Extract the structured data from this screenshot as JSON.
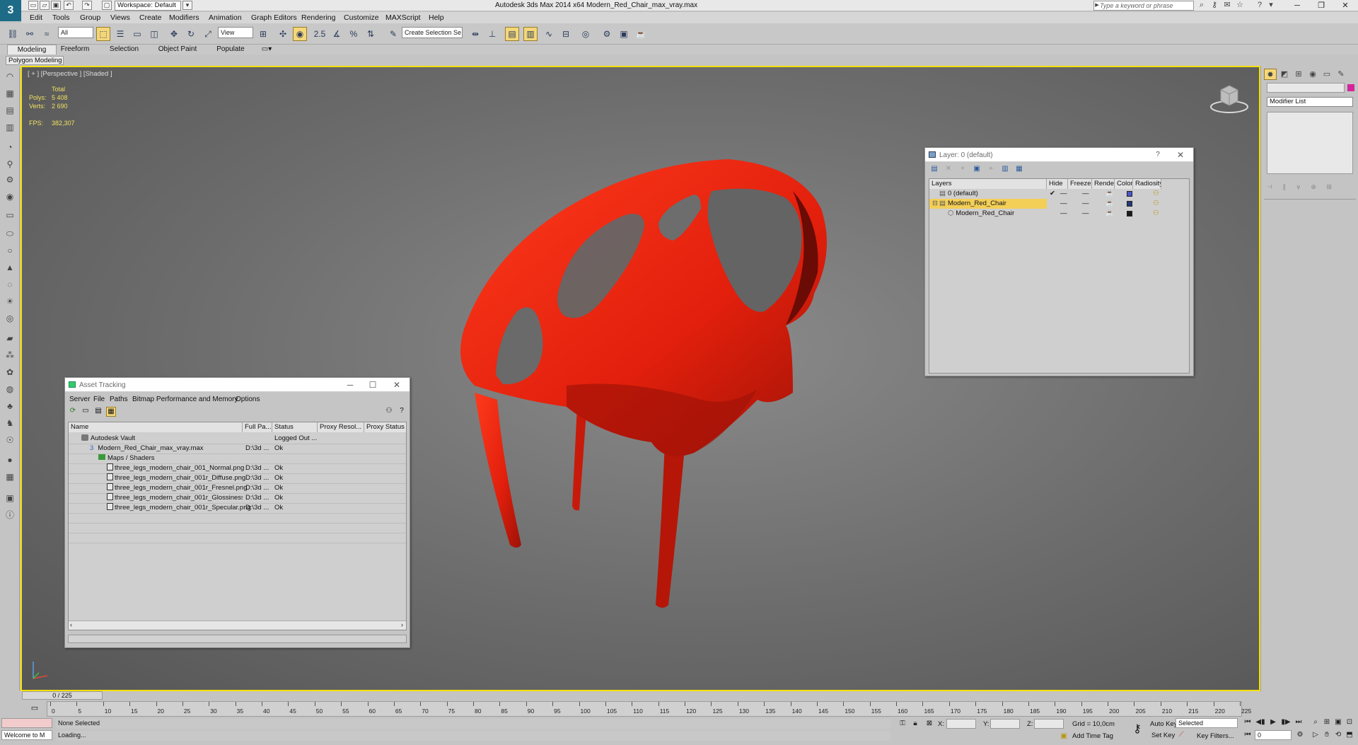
{
  "app": {
    "title": "Autodesk 3ds Max  2014 x64     Modern_Red_Chair_max_vray.max",
    "workspace": "Workspace: Default",
    "search_placeholder": "Type a keyword or phrase"
  },
  "menu": [
    "Edit",
    "Tools",
    "Group",
    "Views",
    "Create",
    "Modifiers",
    "Animation",
    "Graph Editors",
    "Rendering",
    "Customize",
    "MAXScript",
    "Help"
  ],
  "toolbar": {
    "filter": "All",
    "coord": "View",
    "selection_set": "Create Selection Se"
  },
  "ribbon": {
    "tabs": [
      "Modeling",
      "Freeform",
      "Selection",
      "Object Paint",
      "Populate"
    ],
    "sub": "Polygon Modeling"
  },
  "viewport": {
    "label": "[ + ] [Perspective ] [Shaded ]",
    "stats": {
      "total": "Total",
      "polys_label": "Polys:",
      "polys": "5 408",
      "verts_label": "Verts:",
      "verts": "2 690",
      "fps_label": "FPS:",
      "fps": "382,307"
    }
  },
  "colors": {
    "chair": "#e32410",
    "chair_dark": "#8a0e06",
    "highlight": "#f5e000",
    "selected_row": "#f3cf58"
  },
  "asset_tracking": {
    "title": "Asset Tracking",
    "menu": [
      "Server",
      "File",
      "Paths",
      "Bitmap Performance and Memory",
      "Options"
    ],
    "columns": [
      "Name",
      "Full Pa...",
      "Status",
      "Proxy Resol...",
      "Proxy Status"
    ],
    "rows": [
      {
        "name": "Autodesk Vault",
        "path": "",
        "status": "Logged Out ..."
      },
      {
        "name": "Modern_Red_Chair_max_vray.max",
        "path": "D:\\3d ...",
        "status": "Ok"
      },
      {
        "name": "Maps / Shaders",
        "path": "",
        "status": ""
      },
      {
        "name": "three_legs_modern_chair_001_Normal.png",
        "path": "D:\\3d ...",
        "status": "Ok"
      },
      {
        "name": "three_legs_modern_chair_001r_Diffuse.png",
        "path": "D:\\3d ...",
        "status": "Ok"
      },
      {
        "name": "three_legs_modern_chair_001r_Fresnel.png",
        "path": "D:\\3d ...",
        "status": "Ok"
      },
      {
        "name": "three_legs_modern_chair_001r_Glossiness.p...",
        "path": "D:\\3d ...",
        "status": "Ok"
      },
      {
        "name": "three_legs_modern_chair_001r_Specular.png",
        "path": "D:\\3d ...",
        "status": "Ok"
      }
    ]
  },
  "layer_window": {
    "title": "Layer: 0 (default)",
    "columns": [
      "Layers",
      "Hide",
      "Freeze",
      "Render",
      "Color",
      "Radiosity"
    ],
    "rows": [
      {
        "name": "0 (default)",
        "color": "#4b55c8"
      },
      {
        "name": "Modern_Red_Chair",
        "color": "#223a7a"
      },
      {
        "name": "Modern_Red_Chair",
        "color": "#1a1a1a"
      }
    ]
  },
  "command_panel": {
    "modifier_list": "Modifier List"
  },
  "timeline": {
    "slider": "0 / 225",
    "ticks": [
      "0",
      "5",
      "10",
      "15",
      "20",
      "25",
      "30",
      "35",
      "40",
      "45",
      "50",
      "55",
      "60",
      "65",
      "70",
      "75",
      "80",
      "85",
      "90",
      "95",
      "100",
      "105",
      "110",
      "115",
      "120",
      "125",
      "130",
      "135",
      "140",
      "145",
      "150",
      "155",
      "160",
      "165",
      "170",
      "175",
      "180",
      "185",
      "190",
      "195",
      "200",
      "205",
      "210",
      "215",
      "220",
      "225"
    ]
  },
  "status": {
    "selection": "None Selected",
    "loading": "Loading...",
    "welcome": "Welcome to M",
    "x_label": "X:",
    "y_label": "Y:",
    "z_label": "Z:",
    "grid": "Grid = 10,0cm",
    "add_time_tag": "Add Time Tag",
    "auto_key": "Auto Key",
    "selected": "Selected",
    "set_key": "Set Key",
    "key_filters": "Key Filters...",
    "frame": "0"
  }
}
